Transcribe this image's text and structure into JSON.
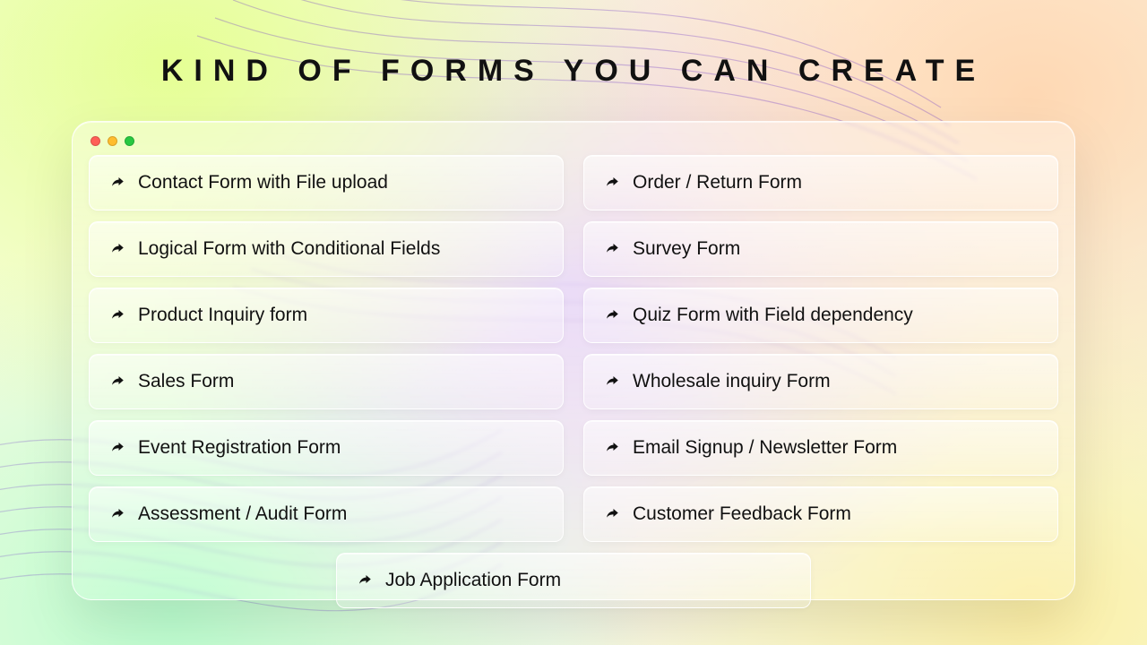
{
  "title": "KIND OF FORMS YOU CAN CREATE",
  "items": [
    "Contact Form with File upload",
    "Order / Return Form",
    "Logical Form with Conditional Fields",
    "Survey Form",
    "Product Inquiry form",
    "Quiz Form with Field dependency",
    "Sales Form",
    "Wholesale inquiry Form",
    "Event Registration Form",
    "Email Signup / Newsletter Form",
    "Assessment / Audit Form",
    "Customer Feedback Form",
    "Job Application Form"
  ],
  "colors": {
    "traffic_red": "#ff5f57",
    "traffic_yellow": "#ffbd2e",
    "traffic_green": "#28c840"
  }
}
